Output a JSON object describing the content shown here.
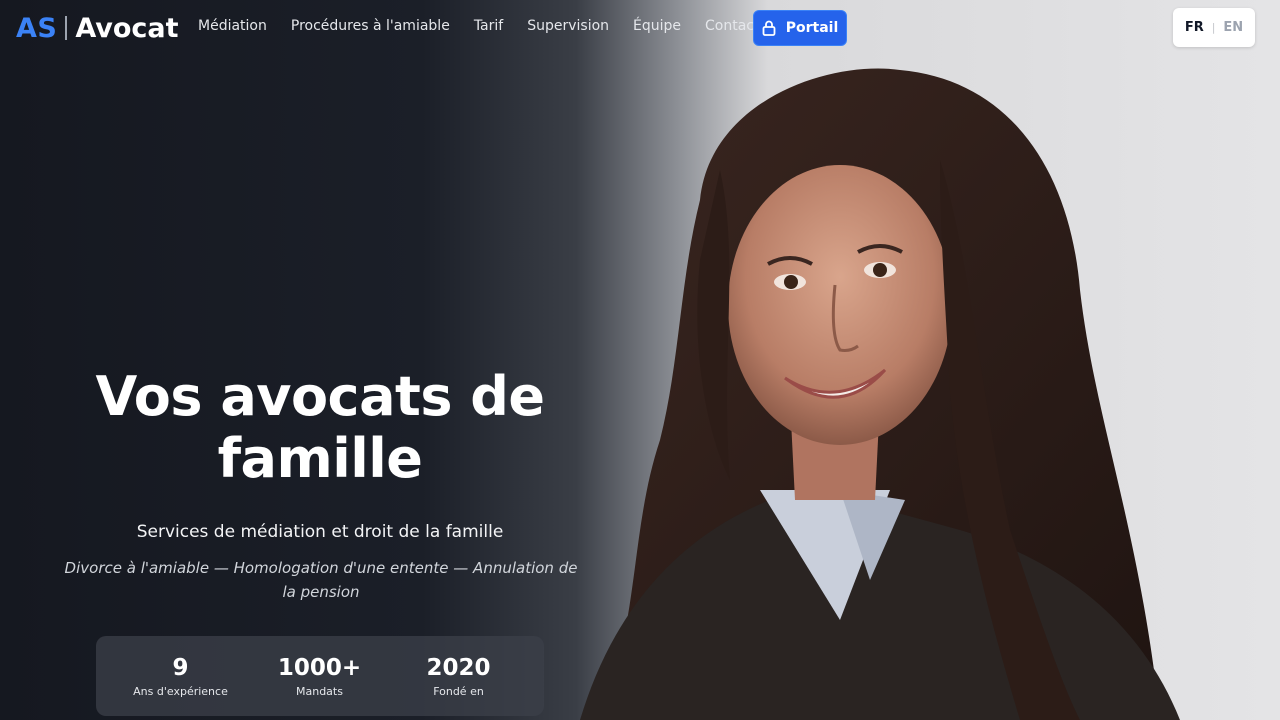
{
  "brand": {
    "initials": "AS",
    "name": "Avocat"
  },
  "nav": {
    "links": [
      "Médiation",
      "Procédures à l'amiable",
      "Tarif",
      "Supervision",
      "Équipe",
      "Contact"
    ],
    "portal_label": "Portail"
  },
  "language": {
    "active": "FR",
    "other": "EN",
    "separator": "|"
  },
  "hero": {
    "headline_line1": "Vos avocats de",
    "headline_line2": "famille",
    "subtitle": "Services de médiation et droit de la famille",
    "services": "Divorce à l'amiable — Homologation d'une entente — Annulation de la pension"
  },
  "stats": [
    {
      "value": "9",
      "label": "Ans d'expérience"
    },
    {
      "value": "1000+",
      "label": "Mandats"
    },
    {
      "value": "2020",
      "label": "Fondé en"
    }
  ],
  "colors": {
    "accent": "#2563eb",
    "brand_blue": "#3b82f6",
    "hero_dark": "#151820"
  },
  "icons": {
    "portal": "lock-icon"
  }
}
